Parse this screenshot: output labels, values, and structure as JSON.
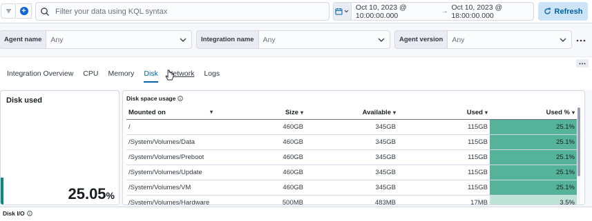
{
  "query_bar": {
    "search_placeholder": "Filter your data using KQL syntax",
    "time_start": "Oct 10, 2023 @ 10:00:00.000",
    "time_end": "Oct 10, 2023 @ 18:00:00.000",
    "refresh_label": "Refresh"
  },
  "filters": [
    {
      "label": "Agent name",
      "value": "Any"
    },
    {
      "label": "Integration name",
      "value": "Any"
    },
    {
      "label": "Agent version",
      "value": "Any"
    }
  ],
  "tabs": [
    "Integration Overview",
    "CPU",
    "Memory",
    "Disk",
    "Network",
    "Logs"
  ],
  "active_tab": "Disk",
  "hovered_tab": "Network",
  "disk_used": {
    "title": "Disk used",
    "value": "25.05",
    "unit": "%"
  },
  "disk_space_table": {
    "title": "Disk space usage",
    "columns": [
      "Mounted on",
      "Size",
      "Available",
      "Used",
      "Used %"
    ],
    "rows": [
      {
        "mounted_on": "/",
        "size": "460GB",
        "available": "345GB",
        "used": "115GB",
        "used_pct": "25.1%",
        "used_pct_value": 25.1
      },
      {
        "mounted_on": "/System/Volumes/Data",
        "size": "460GB",
        "available": "345GB",
        "used": "115GB",
        "used_pct": "25.1%",
        "used_pct_value": 25.1
      },
      {
        "mounted_on": "/System/Volumes/Preboot",
        "size": "460GB",
        "available": "345GB",
        "used": "115GB",
        "used_pct": "25.1%",
        "used_pct_value": 25.1
      },
      {
        "mounted_on": "/System/Volumes/Update",
        "size": "460GB",
        "available": "345GB",
        "used": "115GB",
        "used_pct": "25.1%",
        "used_pct_value": 25.1
      },
      {
        "mounted_on": "/System/Volumes/VM",
        "size": "460GB",
        "available": "345GB",
        "used": "115GB",
        "used_pct": "25.1%",
        "used_pct_value": 25.1
      },
      {
        "mounted_on": "/System/Volumes/Hardware",
        "size": "500MB",
        "available": "483MB",
        "used": "17MB",
        "used_pct": "3.5%",
        "used_pct_value": 3.5
      }
    ]
  },
  "disk_io": {
    "title": "Disk I/O"
  },
  "colors": {
    "accent": "#0061a6",
    "high_usage_cell": "#54b399",
    "low_usage_cell": "#bfe3d6",
    "metric_accent": "#0f8a7a"
  }
}
